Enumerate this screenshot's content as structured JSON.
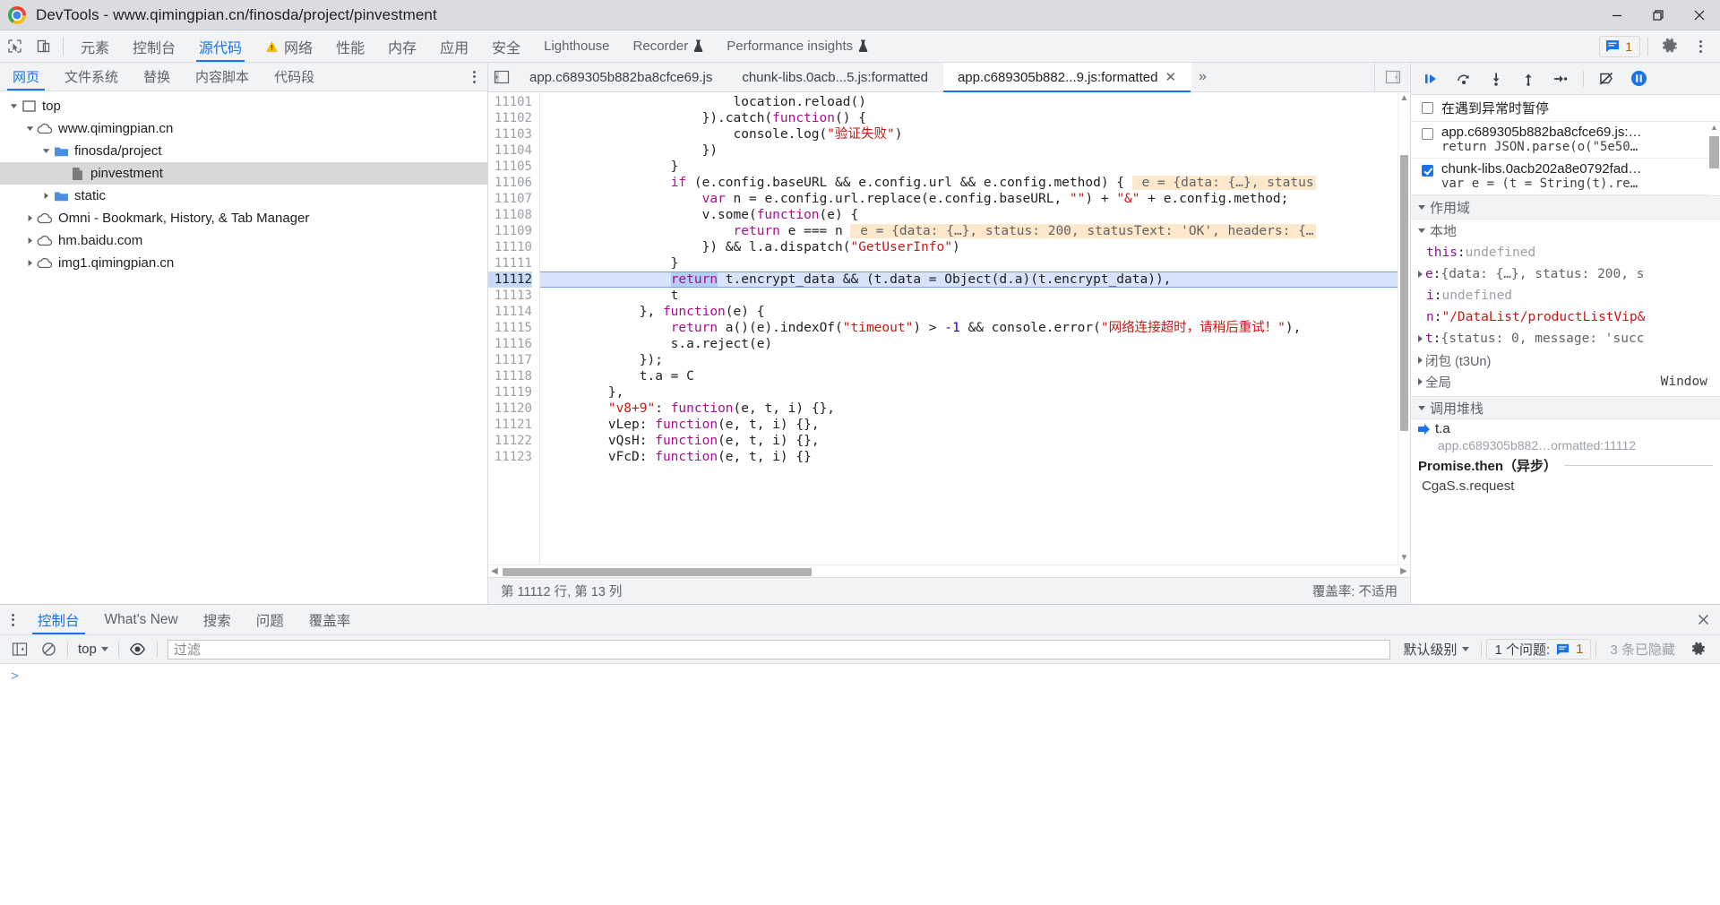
{
  "window": {
    "title": "DevTools - www.qimingpian.cn/finosda/project/pinvestment",
    "controls": {
      "minimize": "minimize-icon",
      "maximize": "maximize-icon",
      "close": "close-icon"
    }
  },
  "main_toolbar": {
    "inspect_icon": "inspect-element-icon",
    "device_icon": "device-toolbar-icon",
    "tabs": [
      {
        "label": "元素",
        "active": false,
        "warn": false
      },
      {
        "label": "控制台",
        "active": false,
        "warn": false
      },
      {
        "label": "源代码",
        "active": true,
        "warn": false
      },
      {
        "label": "网络",
        "active": false,
        "warn": true
      },
      {
        "label": "性能",
        "active": false,
        "warn": false
      },
      {
        "label": "内存",
        "active": false,
        "warn": false
      },
      {
        "label": "应用",
        "active": false,
        "warn": false
      },
      {
        "label": "安全",
        "active": false,
        "warn": false
      },
      {
        "label": "Lighthouse",
        "active": false,
        "warn": false
      },
      {
        "label": "Recorder",
        "active": false,
        "warn": false,
        "flask": true
      },
      {
        "label": "Performance insights",
        "active": false,
        "warn": false,
        "flask": true
      }
    ],
    "messages_count": "1",
    "settings_icon": "gear-icon",
    "more_icon": "kebab-menu-icon"
  },
  "navigator": {
    "tabs": [
      {
        "label": "网页",
        "active": true
      },
      {
        "label": "文件系统",
        "active": false
      },
      {
        "label": "替换",
        "active": false
      },
      {
        "label": "内容脚本",
        "active": false
      },
      {
        "label": "代码段",
        "active": false
      }
    ],
    "tree": [
      {
        "label": "top",
        "depth": 0,
        "icon": "frame-icon",
        "twisty": "down",
        "selected": false
      },
      {
        "label": "www.qimingpian.cn",
        "depth": 1,
        "icon": "cloud-icon",
        "twisty": "down",
        "selected": false
      },
      {
        "label": "finosda/project",
        "depth": 2,
        "icon": "folder-icon",
        "twisty": "down",
        "selected": false
      },
      {
        "label": "pinvestment",
        "depth": 3,
        "icon": "document-icon",
        "twisty": "none",
        "selected": true
      },
      {
        "label": "static",
        "depth": 2,
        "icon": "folder-icon",
        "twisty": "right",
        "selected": false
      },
      {
        "label": "Omni - Bookmark, History, & Tab Manager",
        "depth": 1,
        "icon": "cloud-icon",
        "twisty": "right",
        "selected": false
      },
      {
        "label": "hm.baidu.com",
        "depth": 1,
        "icon": "cloud-icon",
        "twisty": "right",
        "selected": false
      },
      {
        "label": "img1.qimingpian.cn",
        "depth": 1,
        "icon": "cloud-icon",
        "twisty": "right",
        "selected": false
      }
    ]
  },
  "editor": {
    "nav_toggle_icon": "show-navigator-icon",
    "tabs": [
      {
        "label": "app.c689305b882ba8cfce69.js",
        "active": false,
        "closable": false
      },
      {
        "label": "chunk-libs.0acb...5.js:formatted",
        "active": false,
        "closable": false
      },
      {
        "label": "app.c689305b882...9.js:formatted",
        "active": true,
        "closable": true
      }
    ],
    "more_tabs": "»",
    "debugger_toggle_icon": "show-debugger-icon",
    "first_line_number": 11101,
    "lines": [
      {
        "n": 11101,
        "tokens": [
          {
            "t": "                        location.reload()",
            "c": ""
          }
        ]
      },
      {
        "n": 11102,
        "tokens": [
          {
            "t": "                    }).catch(",
            "c": ""
          },
          {
            "t": "function",
            "c": "kw"
          },
          {
            "t": "() {",
            "c": ""
          }
        ]
      },
      {
        "n": 11103,
        "tokens": [
          {
            "t": "                        console.log(",
            "c": ""
          },
          {
            "t": "\"验证失败\"",
            "c": "k"
          },
          {
            "t": ")",
            "c": ""
          }
        ]
      },
      {
        "n": 11104,
        "tokens": [
          {
            "t": "                    })",
            "c": ""
          }
        ]
      },
      {
        "n": 11105,
        "tokens": [
          {
            "t": "                }",
            "c": ""
          }
        ]
      },
      {
        "n": 11106,
        "tokens": [
          {
            "t": "                ",
            "c": ""
          },
          {
            "t": "if",
            "c": "kw"
          },
          {
            "t": " (e.config.baseURL && e.config.url && e.config.method) { ",
            "c": ""
          },
          {
            "t": " e = {data: {…}, status",
            "c": "hint"
          }
        ]
      },
      {
        "n": 11107,
        "tokens": [
          {
            "t": "                    ",
            "c": ""
          },
          {
            "t": "var",
            "c": "kw"
          },
          {
            "t": " n = e.config.url.replace(e.config.baseURL, ",
            "c": ""
          },
          {
            "t": "\"\"",
            "c": "k"
          },
          {
            "t": ") + ",
            "c": ""
          },
          {
            "t": "\"&\"",
            "c": "k"
          },
          {
            "t": " + e.config.method;",
            "c": ""
          }
        ]
      },
      {
        "n": 11108,
        "tokens": [
          {
            "t": "                    v.some(",
            "c": ""
          },
          {
            "t": "function",
            "c": "kw"
          },
          {
            "t": "(e) {",
            "c": ""
          }
        ]
      },
      {
        "n": 11109,
        "tokens": [
          {
            "t": "                        ",
            "c": ""
          },
          {
            "t": "return",
            "c": "kw"
          },
          {
            "t": " e === n ",
            "c": ""
          },
          {
            "t": " e = {data: {…}, status: 200, statusText: 'OK', headers: {…",
            "c": "hint"
          }
        ]
      },
      {
        "n": 11110,
        "tokens": [
          {
            "t": "                    }) && l.a.dispatch(",
            "c": ""
          },
          {
            "t": "\"GetUserInfo\"",
            "c": "k"
          },
          {
            "t": ")",
            "c": ""
          }
        ]
      },
      {
        "n": 11111,
        "tokens": [
          {
            "t": "                }",
            "c": ""
          }
        ]
      },
      {
        "n": 11112,
        "exec": true,
        "tokens": [
          {
            "t": "                ",
            "c": ""
          },
          {
            "t": "return",
            "c": "kw sel"
          },
          {
            "t": " t.encrypt_data && (t.data = Object(d.a)(t.encrypt_data)),",
            "c": ""
          }
        ]
      },
      {
        "n": 11113,
        "tokens": [
          {
            "t": "                t",
            "c": ""
          }
        ]
      },
      {
        "n": 11114,
        "tokens": [
          {
            "t": "            }, ",
            "c": ""
          },
          {
            "t": "function",
            "c": "kw"
          },
          {
            "t": "(e) {",
            "c": ""
          }
        ]
      },
      {
        "n": 11115,
        "tokens": [
          {
            "t": "                ",
            "c": ""
          },
          {
            "t": "return",
            "c": "kw"
          },
          {
            "t": " a()(e).indexOf(",
            "c": ""
          },
          {
            "t": "\"timeout\"",
            "c": "k"
          },
          {
            "t": ") > ",
            "c": ""
          },
          {
            "t": "-1",
            "c": "num"
          },
          {
            "t": " && console.error(",
            "c": ""
          },
          {
            "t": "\"网络连接超时，请稍后重试！\"",
            "c": "k"
          },
          {
            "t": "),",
            "c": ""
          }
        ]
      },
      {
        "n": 11116,
        "tokens": [
          {
            "t": "                s.a.reject(e)",
            "c": ""
          }
        ]
      },
      {
        "n": 11117,
        "tokens": [
          {
            "t": "            });",
            "c": ""
          }
        ]
      },
      {
        "n": 11118,
        "tokens": [
          {
            "t": "            t.a = C",
            "c": ""
          }
        ]
      },
      {
        "n": 11119,
        "tokens": [
          {
            "t": "        },",
            "c": ""
          }
        ]
      },
      {
        "n": 11120,
        "tokens": [
          {
            "t": "        ",
            "c": ""
          },
          {
            "t": "\"v8+9\"",
            "c": "k"
          },
          {
            "t": ": ",
            "c": ""
          },
          {
            "t": "function",
            "c": "kw"
          },
          {
            "t": "(e, t, i) {},",
            "c": ""
          }
        ]
      },
      {
        "n": 11121,
        "tokens": [
          {
            "t": "        vLep: ",
            "c": ""
          },
          {
            "t": "function",
            "c": "kw"
          },
          {
            "t": "(e, t, i) {},",
            "c": ""
          }
        ]
      },
      {
        "n": 11122,
        "tokens": [
          {
            "t": "        vQsH: ",
            "c": ""
          },
          {
            "t": "function",
            "c": "kw"
          },
          {
            "t": "(e, t, i) {},",
            "c": ""
          }
        ]
      },
      {
        "n": 11123,
        "tokens": [
          {
            "t": "        vFcD: ",
            "c": ""
          },
          {
            "t": "function",
            "c": "kw"
          },
          {
            "t": "(e, t, i) {}",
            "c": ""
          }
        ]
      }
    ],
    "status_left": "第 11112 行, 第 13 列",
    "status_right": "覆盖率: 不适用"
  },
  "debugger": {
    "toolbar_icons": [
      "resume-script-icon",
      "step-over-icon",
      "step-into-icon",
      "step-out-icon",
      "step-icon",
      "deactivate-breakpoints-icon",
      "pause-on-exceptions-icon"
    ],
    "pause_on_exceptions": {
      "label": "在遇到异常时暂停",
      "checked": false
    },
    "breakpoints": [
      {
        "checked": false,
        "file": "app.c689305b882ba8cfce69.js:…",
        "code": "return JSON.parse(o(\"5e50…"
      },
      {
        "checked": true,
        "file": "chunk-libs.0acb202a8e0792fad…",
        "code": "var e = (t = String(t).re…"
      }
    ],
    "scope_section": "作用域",
    "scope_local": "本地",
    "locals": [
      {
        "expandable": false,
        "name": "this",
        "sep": ": ",
        "value": "undefined",
        "vclass": "vundef"
      },
      {
        "expandable": true,
        "name": "e",
        "sep": ": ",
        "value": "{data: {…}, status: 200, s",
        "vclass": "vobj"
      },
      {
        "expandable": false,
        "name": "i",
        "sep": ": ",
        "value": "undefined",
        "vclass": "vundef"
      },
      {
        "expandable": false,
        "name": "n",
        "sep": ": ",
        "value": "\"/DataList/productListVip&",
        "vclass": "vstr"
      },
      {
        "expandable": true,
        "name": "t",
        "sep": ": ",
        "value": "{status: 0, message: 'succ",
        "vclass": "vobj"
      }
    ],
    "closure_label": "闭包 (t3Un)",
    "global_label": "全局",
    "global_value": "Window",
    "callstack_section": "调用堆栈",
    "callstack": [
      {
        "current": true,
        "fn": "t.a",
        "loc": "app.c689305b882…ormatted:11112"
      }
    ],
    "async_label": "Promise.then（异步）",
    "async_frame": "CgaS.s.request"
  },
  "drawer": {
    "tabs": [
      {
        "label": "控制台",
        "active": true
      },
      {
        "label": "What's New",
        "active": false
      },
      {
        "label": "搜索",
        "active": false
      },
      {
        "label": "问题",
        "active": false
      },
      {
        "label": "覆盖率",
        "active": false
      }
    ],
    "close_icon": "close-drawer-icon",
    "console_toolbar": {
      "sidebar_icon": "console-sidebar-icon",
      "clear_icon": "clear-console-icon",
      "context": "top",
      "eye_icon": "live-expression-icon",
      "filter_placeholder": "过滤",
      "level": "默认级别",
      "issues_label": "1 个问题:",
      "issues_count": "1",
      "hidden_label": "3 条已隐藏",
      "settings_icon": "console-settings-icon"
    },
    "prompt": ">"
  },
  "colors": {
    "accent": "#1a73e8",
    "toolbar_bg": "#f1f3f4",
    "titlebar_bg": "#dadce0",
    "exec_line": "#d6e3fb",
    "hint_bg": "#fde8cc",
    "string": "#c41a16",
    "keyword": "#aa0d91",
    "number": "#1c00cf"
  }
}
